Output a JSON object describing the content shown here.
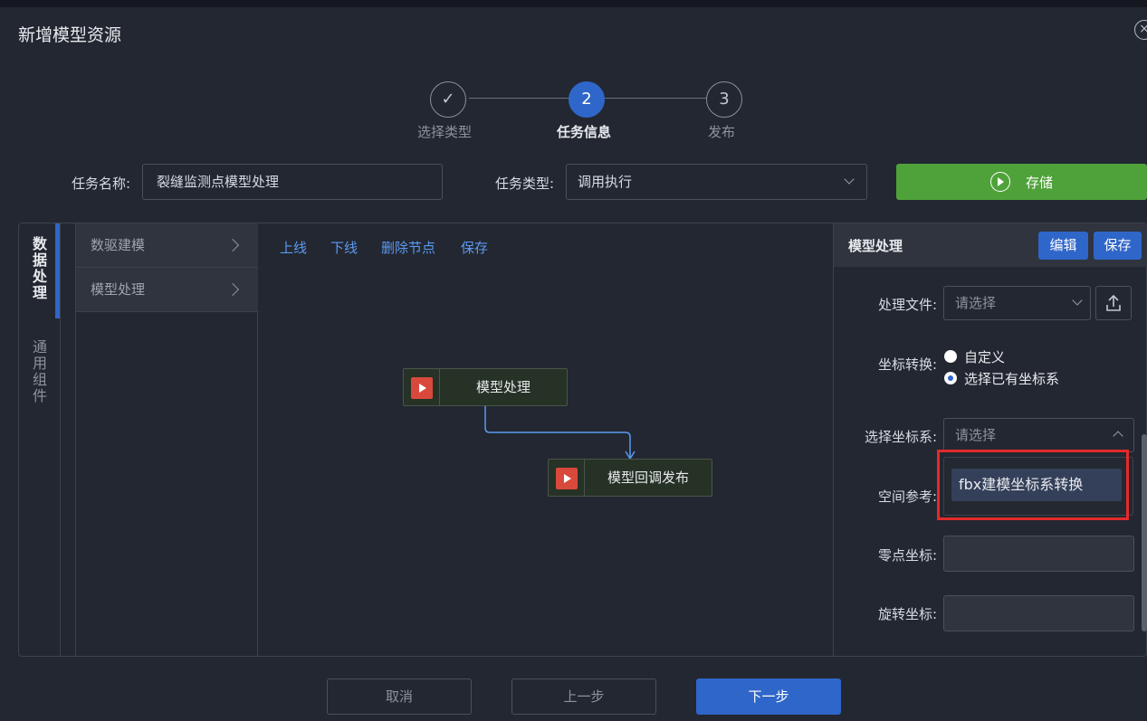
{
  "dialog": {
    "title": "新增模型资源",
    "close_glyph": "×"
  },
  "steps": [
    {
      "label": "选择类型",
      "glyph": "✓",
      "state": "done"
    },
    {
      "label": "任务信息",
      "glyph": "2",
      "state": "active"
    },
    {
      "label": "发布",
      "glyph": "3",
      "state": "todo"
    }
  ],
  "form": {
    "task_name_label": "任务名称:",
    "task_name_value": "裂缝监测点模型处理",
    "task_type_label": "任务类型:",
    "task_type_value": "调用执行",
    "store_label": "存储"
  },
  "sidebar": {
    "tabs": [
      {
        "label": "数据处理",
        "active": true
      },
      {
        "label": "通用组件",
        "active": false
      }
    ]
  },
  "categories": [
    {
      "label": "数驱建模"
    },
    {
      "label": "模型处理"
    }
  ],
  "canvas": {
    "toolbar": [
      "上线",
      "下线",
      "删除节点",
      "保存"
    ],
    "nodes": [
      {
        "label": "模型处理"
      },
      {
        "label": "模型回调发布"
      }
    ]
  },
  "properties": {
    "title": "模型处理",
    "edit_label": "编辑",
    "save_label": "保存",
    "file_label": "处理文件:",
    "file_placeholder": "请选择",
    "coord_label": "坐标转换:",
    "radio_custom": "自定义",
    "radio_existing": "选择已有坐标系",
    "crs_label": "选择坐标系:",
    "crs_placeholder": "请选择",
    "spatial_label": "空间参考:",
    "origin_label": "零点坐标:",
    "rotation_label": "旋转坐标:",
    "dropdown_option": "fbx建模坐标系转换"
  },
  "footer": {
    "cancel": "取消",
    "prev": "上一步",
    "next": "下一步"
  },
  "colors": {
    "accent": "#2f66c9",
    "success": "#4fa23a",
    "danger": "#d9493b",
    "highlight": "#e32a2a"
  }
}
